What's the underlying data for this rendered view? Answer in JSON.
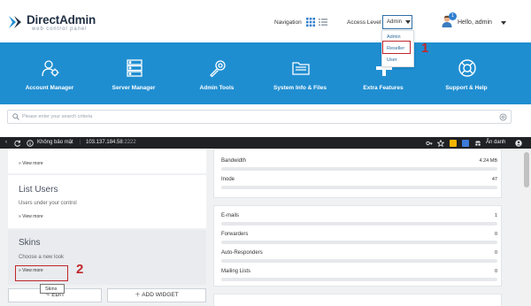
{
  "app": {
    "title": "DirectAdmin",
    "subtitle": "web control panel"
  },
  "header": {
    "navigation_label": "Navigation",
    "access_level_label": "Access Level",
    "access_level_value": "Admin",
    "access_level_options": [
      "Admin",
      "Reseller",
      "User"
    ],
    "notification_count": "1",
    "greeting": "Hello, admin"
  },
  "annotations": {
    "step_1": "1",
    "step_2": "2"
  },
  "menu": [
    {
      "label": "Account Manager",
      "icon": "users-gear-icon"
    },
    {
      "label": "Server Manager",
      "icon": "server-icon"
    },
    {
      "label": "Admin Tools",
      "icon": "tools-icon"
    },
    {
      "label": "System Info & Files",
      "icon": "folder-icon"
    },
    {
      "label": "Extra Features",
      "icon": "plus-icon"
    },
    {
      "label": "Support & Help",
      "icon": "lifebuoy-icon"
    }
  ],
  "search": {
    "placeholder": "Please enter your search criteria"
  },
  "browser": {
    "security_label": "Không bảo mật",
    "url_host": "103.137.184.58",
    "url_port": ":2222",
    "incognito_label": "Ẩn danh"
  },
  "left_cards": [
    {
      "title": "",
      "description": "",
      "link": "» View more"
    },
    {
      "title": "List Users",
      "description": "Users under your control",
      "link": "» View more"
    },
    {
      "title": "Skins",
      "description": "Choose a new look",
      "link": "» View more"
    }
  ],
  "tooltip": "Skins",
  "buttons": {
    "edit": "EDIT",
    "add_widget": "ADD WIDGET"
  },
  "stats_group_1": [
    {
      "label": "Bandwidth",
      "value": "4.24 MB"
    },
    {
      "label": "Inode",
      "value": "47"
    }
  ],
  "stats_group_2": [
    {
      "label": "E-mails",
      "value": "1"
    },
    {
      "label": "Forwarders",
      "value": "0"
    },
    {
      "label": "Auto-Responders",
      "value": "0"
    },
    {
      "label": "Mailing Lists",
      "value": "0"
    }
  ],
  "colors": {
    "brand_blue": "#1f8ed1",
    "highlight_red": "#c0262b",
    "browser_dark": "#202124"
  }
}
